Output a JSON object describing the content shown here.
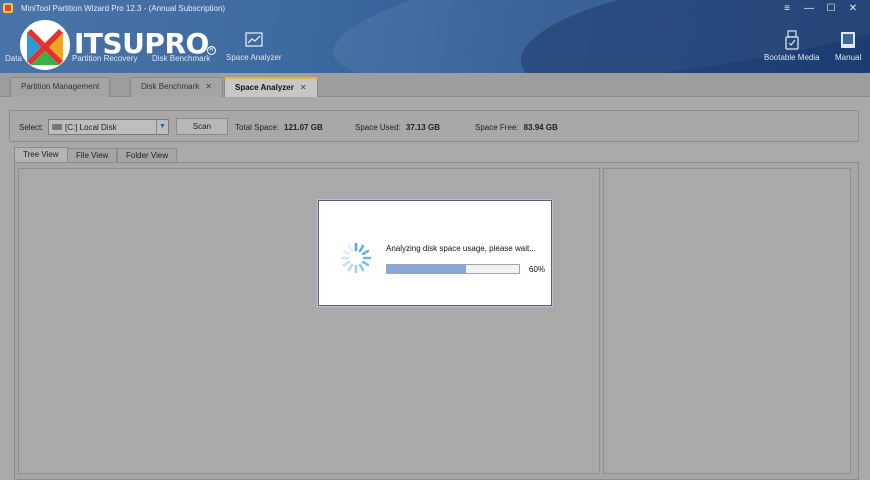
{
  "window": {
    "title": "MiniTool Partition Wizard Pro 12.3 - (Annual Subscription)",
    "controls": [
      "≡",
      "—",
      "☐",
      "✕"
    ]
  },
  "watermark": {
    "text": "ITSUPRO",
    "reg": "R"
  },
  "toolbar": {
    "left_tools": [
      {
        "label": "Data",
        "icon": "data-recovery-icon"
      },
      {
        "label": "Partition Recovery",
        "icon": "partition-recovery-icon"
      },
      {
        "label": "Disk Benchmark",
        "icon": "disk-benchmark-icon"
      },
      {
        "label": "Space Analyzer",
        "icon": "space-analyzer-icon"
      }
    ],
    "right_tools": [
      {
        "label": "Bootable Media",
        "icon": "usb-icon"
      },
      {
        "label": "Manual",
        "icon": "book-icon"
      }
    ]
  },
  "main_tabs": [
    {
      "label": "Partition Management",
      "closable": false,
      "active": false
    },
    {
      "label": "Disk Benchmark",
      "closable": true,
      "active": false
    },
    {
      "label": "Space Analyzer",
      "closable": true,
      "active": true
    }
  ],
  "select_bar": {
    "select_label": "Select:",
    "drive_value": "[C:] Local Disk",
    "scan_label": "Scan",
    "total_label": "Total Space:",
    "total_value": "121.07 GB",
    "used_label": "Space Used:",
    "used_value": "37.13 GB",
    "free_label": "Space Free:",
    "free_value": "83.94 GB"
  },
  "view_tabs": [
    "Tree View",
    "File View",
    "Folder View"
  ],
  "dialog": {
    "message": "Analyzing disk space usage, please wait...",
    "progress": 0.6,
    "progress_text": "60%"
  },
  "colors": {
    "accent": "#e6b23a",
    "progress": "#86a8d8",
    "ribbon": "#3c6aa0"
  }
}
